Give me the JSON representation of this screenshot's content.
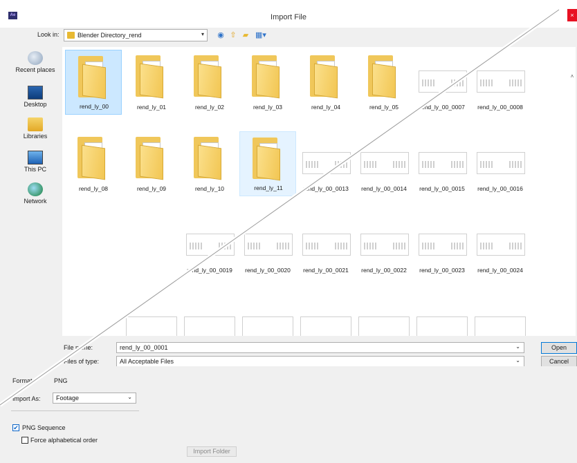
{
  "window": {
    "app_icon_text": "Ae",
    "title": "Import File",
    "close_glyph": "×"
  },
  "toolbar": {
    "look_in_label": "Look in:",
    "look_in_value": "Blender Directory_rend",
    "back_icon": "back-arrow-icon",
    "up_icon": "up-folder-icon",
    "new_folder_icon": "new-folder-icon",
    "view_icon": "view-menu-icon"
  },
  "places": [
    {
      "label": "Recent places",
      "icon": "recent-places-icon"
    },
    {
      "label": "Desktop",
      "icon": "desktop-icon"
    },
    {
      "label": "Libraries",
      "icon": "libraries-icon"
    },
    {
      "label": "This PC",
      "icon": "this-pc-icon"
    },
    {
      "label": "Network",
      "icon": "network-icon"
    }
  ],
  "files": [
    {
      "name": "rend_ly_00",
      "kind": "folder",
      "state": "selected"
    },
    {
      "name": "rend_ly_01",
      "kind": "folder"
    },
    {
      "name": "rend_ly_02",
      "kind": "folder"
    },
    {
      "name": "rend_ly_03",
      "kind": "folder"
    },
    {
      "name": "rend_ly_04",
      "kind": "folder-red"
    },
    {
      "name": "rend_ly_05",
      "kind": "folder"
    },
    {
      "name": "rend_ly_00_0007",
      "kind": "image"
    },
    {
      "name": "rend_ly_00_0008",
      "kind": "image"
    },
    {
      "name": "rend_ly_08",
      "kind": "folder"
    },
    {
      "name": "rend_ly_09",
      "kind": "folder"
    },
    {
      "name": "rend_ly_10",
      "kind": "folder"
    },
    {
      "name": "rend_ly_11",
      "kind": "folder",
      "state": "hover"
    },
    {
      "name": "rend_ly_00_0013",
      "kind": "image"
    },
    {
      "name": "rend_ly_00_0014",
      "kind": "image"
    },
    {
      "name": "rend_ly_00_0015",
      "kind": "image"
    },
    {
      "name": "rend_ly_00_0016",
      "kind": "image"
    },
    {
      "name": "rend_ly_00_0019",
      "kind": "image"
    },
    {
      "name": "rend_ly_00_0020",
      "kind": "image"
    },
    {
      "name": "rend_ly_00_0021",
      "kind": "image"
    },
    {
      "name": "rend_ly_00_0022",
      "kind": "image"
    },
    {
      "name": "rend_ly_00_0023",
      "kind": "image"
    },
    {
      "name": "rend_ly_00_0024",
      "kind": "image"
    }
  ],
  "form": {
    "file_name_label": "File name:",
    "file_name_value": "rend_ly_00_0001",
    "file_type_label": "Files of type:",
    "file_type_value": "All Acceptable Files",
    "open_label": "Open",
    "cancel_label": "Cancel"
  },
  "options": {
    "format_label": "Format:",
    "format_value": "PNG",
    "import_as_label": "Import As:",
    "import_as_value": "Footage",
    "png_sequence_label": "PNG Sequence",
    "png_sequence_checked": true,
    "force_alpha_label": "Force alphabetical order",
    "force_alpha_checked": false,
    "import_folder_label": "Import Folder"
  }
}
